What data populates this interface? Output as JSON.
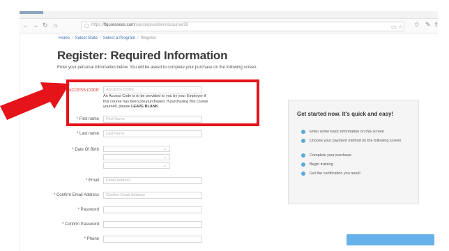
{
  "browser": {
    "url_prefix": "https://",
    "url_domain": "flquoraseas.com",
    "url_path": "/courseplus/demoscourse/28"
  },
  "breadcrumb": {
    "items": [
      "Home",
      "Select State",
      "Select a Program"
    ],
    "current": "Register"
  },
  "page": {
    "title": "Register: Required Information",
    "intro": "Enter your personal information below. You will be asked to complete your purchase on the following screen."
  },
  "form": {
    "access_code": {
      "label": "ACCESS CODE",
      "placeholder": "ACCESS CODE",
      "note": "An Access Code is to be provided to you by your Employer if this course has been pre-purchased. If purchasing this course yourself, please",
      "note_strong": "LEAVE BLANK."
    },
    "first_name": {
      "label": "* First name",
      "placeholder": "First Name"
    },
    "last_name": {
      "label": "* Last name",
      "placeholder": "Last Name"
    },
    "dob": {
      "label": "* Date Of Birth"
    },
    "email": {
      "label": "* Email",
      "placeholder": "Email Address"
    },
    "confirm_email": {
      "label": "* Confirm Email Address",
      "placeholder": "Confirm Email Address"
    },
    "password": {
      "label": "* Password",
      "placeholder": ""
    },
    "confirm_password": {
      "label": "* Confirm Password",
      "placeholder": ""
    },
    "phone": {
      "label": "* Phone",
      "placeholder": ""
    }
  },
  "panel": {
    "title": "Get started now. It's quick and easy!",
    "steps": [
      "Enter some basic information on this screen",
      "Choose your payment method on the following screen",
      "Complete your purchase",
      "Begin training",
      "Get the certification you need!"
    ]
  },
  "colors": {
    "highlight": "#e5141b",
    "link": "#3b6fb0",
    "step_dot": "#5aa9d8",
    "required_label": "#d23a2c"
  }
}
